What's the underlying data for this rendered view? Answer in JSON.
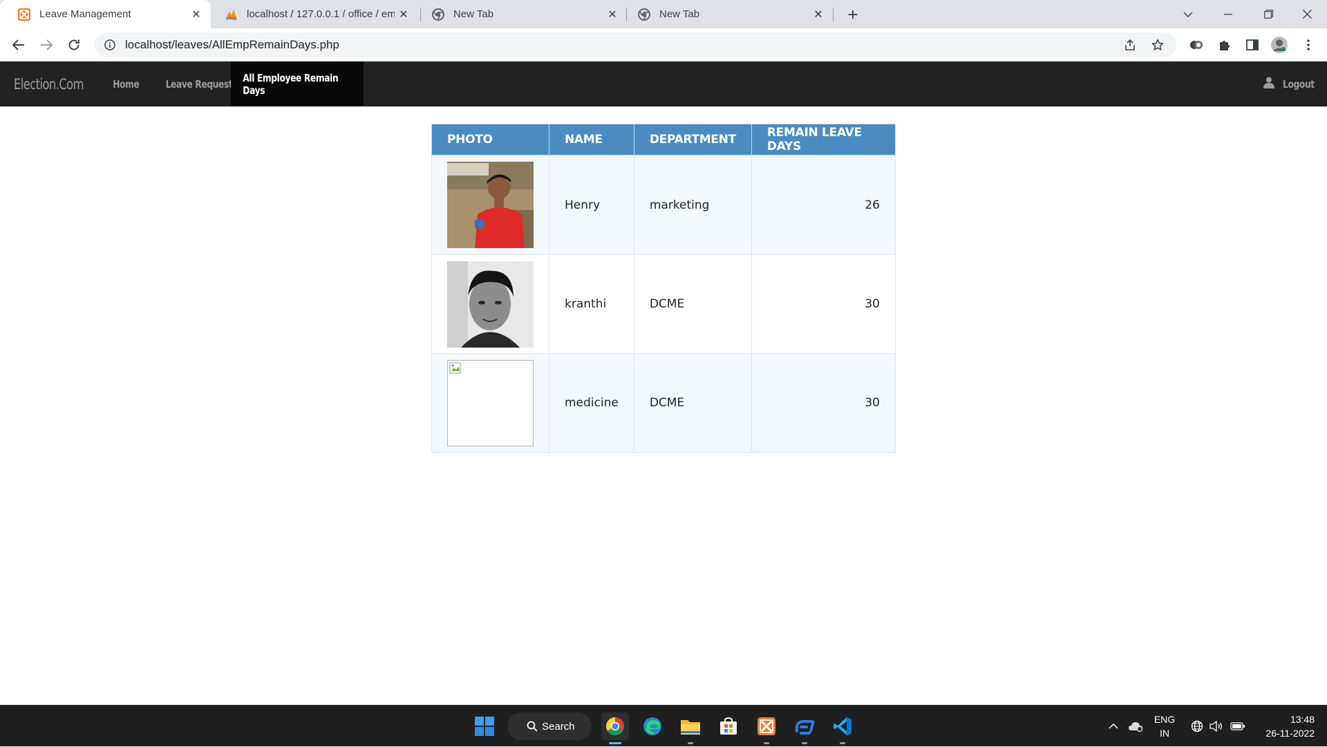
{
  "browser": {
    "tabs": [
      {
        "title": "Leave Management",
        "favicon": "xampp-icon",
        "active": true
      },
      {
        "title": "localhost / 127.0.0.1 / office / em",
        "favicon": "phpmyadmin-icon",
        "active": false
      },
      {
        "title": "New Tab",
        "favicon": "chrome-icon",
        "active": false
      },
      {
        "title": "New Tab",
        "favicon": "chrome-icon",
        "active": false
      }
    ],
    "url": "localhost/leaves/AllEmpRemainDays.php"
  },
  "navbar": {
    "brand": "Election.Com",
    "links": [
      {
        "label": "Home",
        "active": false
      },
      {
        "label": "Leave Request",
        "active": false
      },
      {
        "label": "All Employee Remain Days",
        "active": true
      }
    ],
    "logout": "Logout"
  },
  "table": {
    "headers": [
      "PHOTO",
      "NAME",
      "DEPARTMENT",
      "REMAIN LEAVE DAYS"
    ],
    "rows": [
      {
        "photo": "color-photo",
        "name": "Henry",
        "department": "marketing",
        "remain": "26"
      },
      {
        "photo": "bw-photo",
        "name": "kranthi",
        "department": "DCME",
        "remain": "30"
      },
      {
        "photo": "broken-image",
        "name": "medicine",
        "department": "DCME",
        "remain": "30"
      }
    ]
  },
  "taskbar": {
    "search_label": "Search",
    "language": "ENG",
    "region": "IN",
    "time": "13:48",
    "date": "26-11-2022"
  },
  "colors": {
    "table_header": "#4a8bc2",
    "navbar_bg": "#222222",
    "navbar_active": "#080808"
  }
}
